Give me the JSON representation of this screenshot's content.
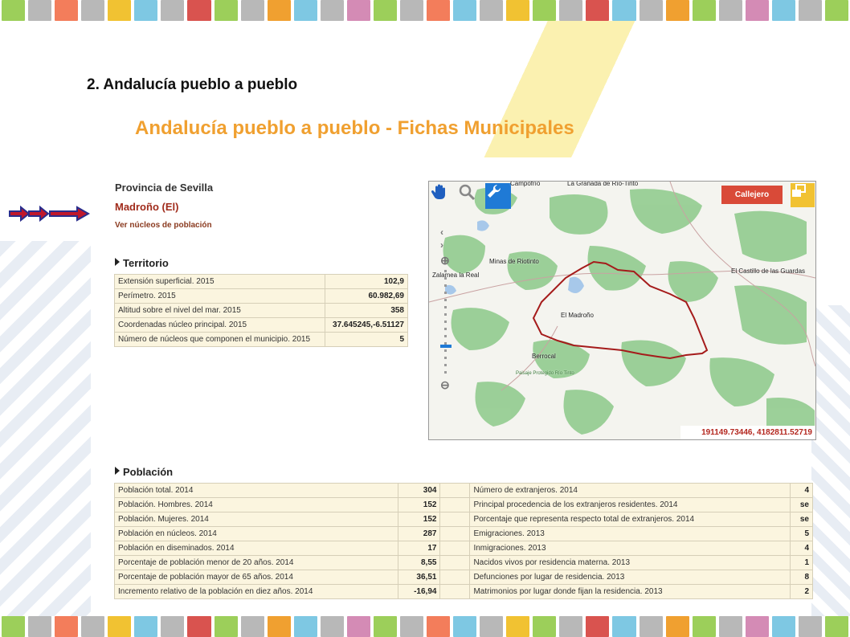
{
  "slide": {
    "section_title": "2.   Andalucía pueblo a pueblo",
    "main_title": "Andalucía pueblo a pueblo - Fichas Municipales"
  },
  "colors": {
    "stripe": [
      "#9ccf5a",
      "#b8b8b8",
      "#f37d5b",
      "#b8b8b8",
      "#f1c232",
      "#7ec8e3",
      "#b8b8b8",
      "#d9534f",
      "#9ccf5a",
      "#b8b8b8",
      "#f0a030",
      "#7ec8e3",
      "#b8b8b8",
      "#d48bb5",
      "#9ccf5a",
      "#b8b8b8",
      "#f37d5b",
      "#7ec8e3",
      "#b8b8b8",
      "#f1c232",
      "#9ccf5a",
      "#b8b8b8",
      "#d9534f",
      "#7ec8e3",
      "#b8b8b8",
      "#f0a030",
      "#9ccf5a",
      "#b8b8b8",
      "#d48bb5",
      "#7ec8e3",
      "#b8b8b8",
      "#9ccf5a"
    ],
    "accent_title": "#f0a030",
    "municipality": "#a02b1b"
  },
  "ficha": {
    "province": "Provincia de Sevilla",
    "municipality": "Madroño (El)",
    "nucleos_link": "Ver núcleos de población"
  },
  "territorio": {
    "heading": "Territorio",
    "rows": [
      {
        "label": "Extensión superficial. 2015",
        "value": "102,9"
      },
      {
        "label": "Perímetro. 2015",
        "value": "60.982,69"
      },
      {
        "label": "Altitud sobre el nivel del mar. 2015",
        "value": "358"
      },
      {
        "label": "Coordenadas núcleo principal. 2015",
        "value": "37.645245,-6.51127"
      },
      {
        "label": "Número de núcleos que componen el municipio. 2015",
        "value": "5"
      }
    ]
  },
  "poblacion": {
    "heading": "Población",
    "rows": [
      {
        "l1": "Población total. 2014",
        "v1": "304",
        "l2": "Número de extranjeros. 2014",
        "v2": "4"
      },
      {
        "l1": "Población. Hombres. 2014",
        "v1": "152",
        "l2": "Principal procedencia de los extranjeros residentes. 2014",
        "v2": "se"
      },
      {
        "l1": "Población. Mujeres. 2014",
        "v1": "152",
        "l2": "Porcentaje que representa respecto total de extranjeros. 2014",
        "v2": "se"
      },
      {
        "l1": "Población en núcleos. 2014",
        "v1": "287",
        "l2": "Emigraciones. 2013",
        "v2": "5"
      },
      {
        "l1": "Población en diseminados. 2014",
        "v1": "17",
        "l2": "Inmigraciones. 2013",
        "v2": "4"
      },
      {
        "l1": "Porcentaje de población menor de 20 años. 2014",
        "v1": "8,55",
        "l2": "Nacidos vivos por residencia materna. 2013",
        "v2": "1"
      },
      {
        "l1": "Porcentaje de población mayor de 65 años. 2014",
        "v1": "36,51",
        "l2": "Defunciones por lugar de residencia. 2013",
        "v2": "8"
      },
      {
        "l1": "Incremento relativo de la población en diez años. 2014",
        "v1": "-16,94",
        "l2": "Matrimonios por lugar donde fijan la residencia. 2013",
        "v2": "2"
      }
    ]
  },
  "map": {
    "callejero_label": "Callejero",
    "coords": "191149.73446, 4182811.52719",
    "places": [
      "Campofrío",
      "La Granada de Río-Tinto",
      "Minas de Riotinto",
      "Zalamea la Real",
      "El Castillo de las Guardas",
      "El Madroño",
      "Berrocal",
      "Paisaje Protegido Río Tinto"
    ],
    "tools": [
      "hand-icon",
      "magnifier-icon",
      "wrench-icon",
      "layers-icon"
    ]
  }
}
